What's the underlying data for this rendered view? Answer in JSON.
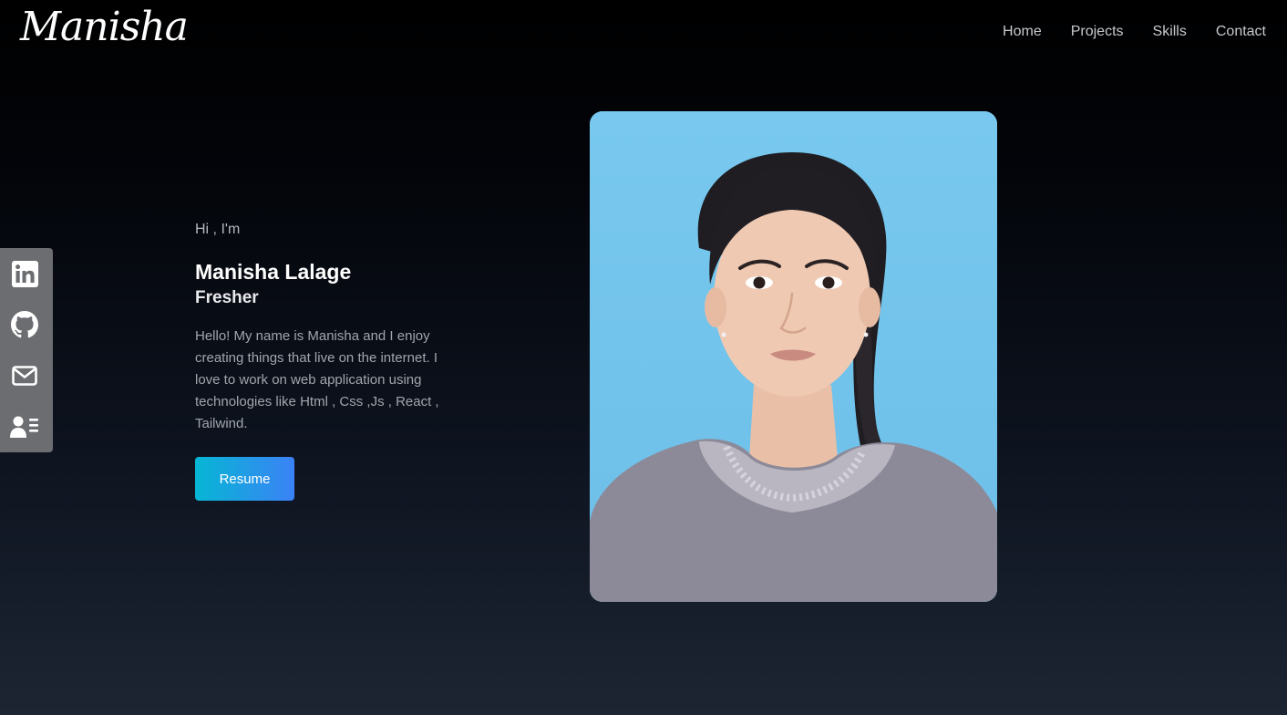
{
  "nav": {
    "logo": "Manisha",
    "links": [
      {
        "label": "Home"
      },
      {
        "label": "Projects"
      },
      {
        "label": "Skills"
      },
      {
        "label": "Contact"
      }
    ]
  },
  "social": [
    {
      "icon": "linkedin-icon"
    },
    {
      "icon": "github-icon"
    },
    {
      "icon": "mail-icon"
    },
    {
      "icon": "profile-icon"
    }
  ],
  "hero": {
    "greeting": "Hi , I'm",
    "name": "Manisha Lalage",
    "role": "Fresher",
    "bio": "Hello! My name is Manisha and I enjoy creating things that live on the internet. I love to work on web application using technologies like Html , Css ,Js , React , Tailwind.",
    "resume_label": "Resume"
  },
  "colors": {
    "button_gradient_start": "#06b6d4",
    "button_gradient_end": "#3b82f6",
    "social_bar": "#6b6d71",
    "photo_background": "#76c6ee"
  }
}
